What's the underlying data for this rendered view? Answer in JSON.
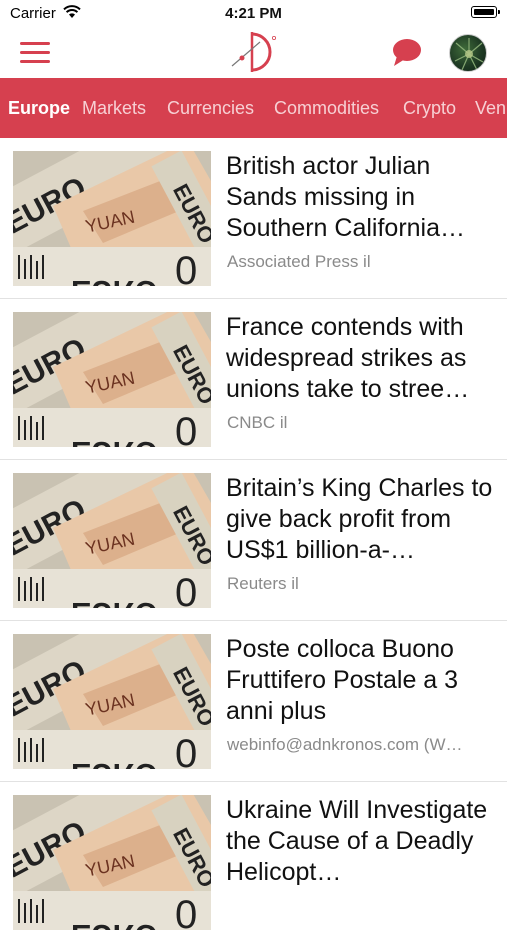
{
  "status_bar": {
    "carrier": "Carrier",
    "time": "4:21 PM"
  },
  "colors": {
    "accent": "#d6404f",
    "tab_inactive_text": "#f7d0d4",
    "source_text": "#8a8a8a"
  },
  "header": {
    "menu_icon": "hamburger-icon",
    "logo_icon": "app-logo",
    "chat_icon": "chat-bubble-icon",
    "avatar": "profile-avatar"
  },
  "tabs": [
    {
      "label": "Europe",
      "active": true
    },
    {
      "label": "Markets",
      "active": false
    },
    {
      "label": "Currencies",
      "active": false
    },
    {
      "label": "Commodities",
      "active": false
    },
    {
      "label": "Crypto",
      "active": false
    },
    {
      "label": "Ven",
      "active": false
    }
  ],
  "articles": [
    {
      "title": "British actor Julian Sands missing in Southern California…",
      "source": "Associated Press il"
    },
    {
      "title": "France contends with widespread strikes as unions take to stree…",
      "source": "CNBC il"
    },
    {
      "title": "Britain’s King Charles to give back profit from US$1 billion-a-…",
      "source": "Reuters il"
    },
    {
      "title": "Poste colloca Buono Fruttifero Postale a 3 anni plus",
      "source": "webinfo@adnkronos.com (W…"
    },
    {
      "title": "Ukraine Will Investigate the Cause of a Deadly Helicopt…",
      "source": ""
    }
  ],
  "thumbnail": {
    "word1": "EURO",
    "word2": "YUAN",
    "word3": "EURO",
    "digit": "0"
  }
}
